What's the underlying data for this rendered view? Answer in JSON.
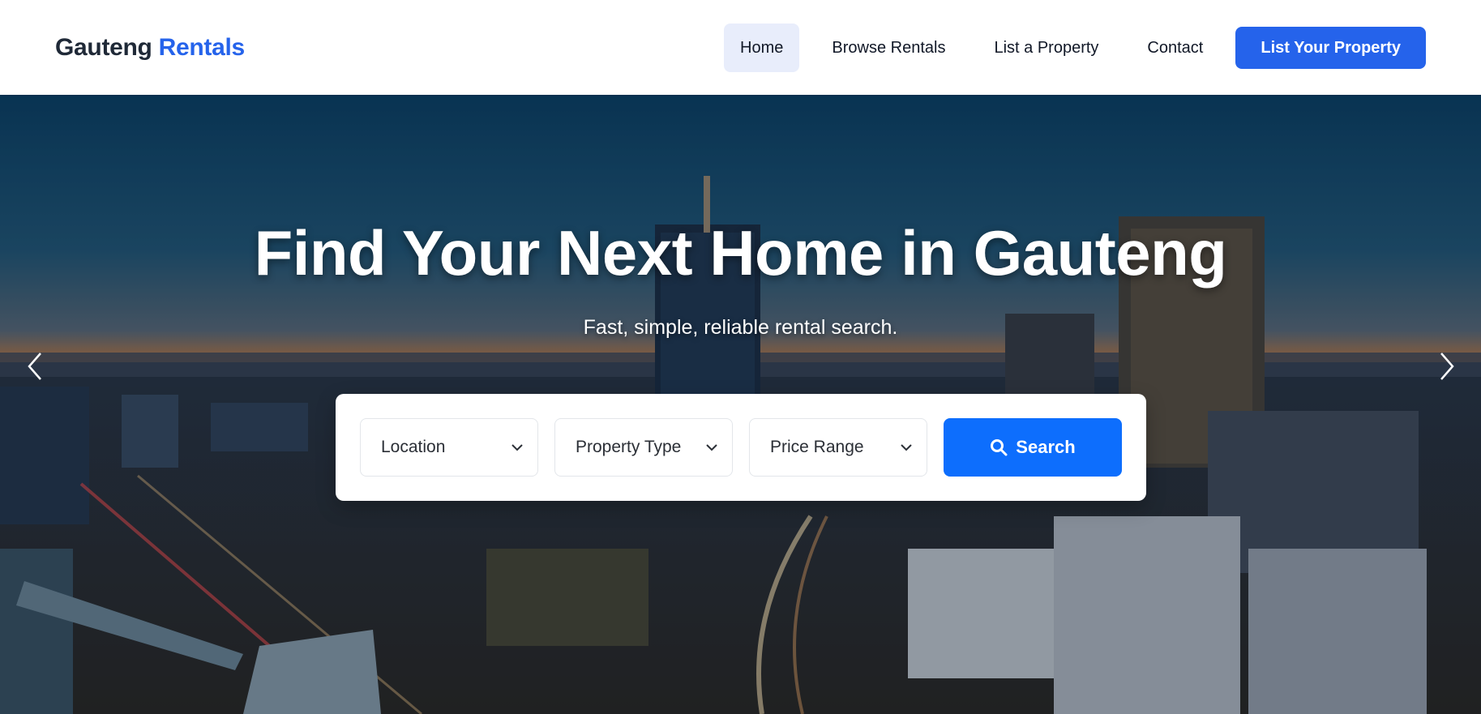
{
  "header": {
    "brand_main": "Gauteng",
    "brand_accent": "Rentals",
    "nav": [
      {
        "label": "Home",
        "active": true
      },
      {
        "label": "Browse Rentals",
        "active": false
      },
      {
        "label": "List a Property",
        "active": false
      },
      {
        "label": "Contact",
        "active": false
      }
    ],
    "cta_label": "List Your Property"
  },
  "hero": {
    "title": "Find Your Next Home in Gauteng",
    "subtitle": "Fast, simple, reliable rental search.",
    "prev_icon": "chevron-left-icon",
    "next_icon": "chevron-right-icon"
  },
  "search": {
    "location_label": "Location",
    "property_type_label": "Property Type",
    "price_range_label": "Price Range",
    "button_label": "Search",
    "button_icon": "search-icon"
  },
  "colors": {
    "brand_accent": "#2563eb",
    "cta_bg": "#2563eb",
    "search_button_bg": "#0d6efd",
    "nav_active_bg": "#e8edfb"
  }
}
